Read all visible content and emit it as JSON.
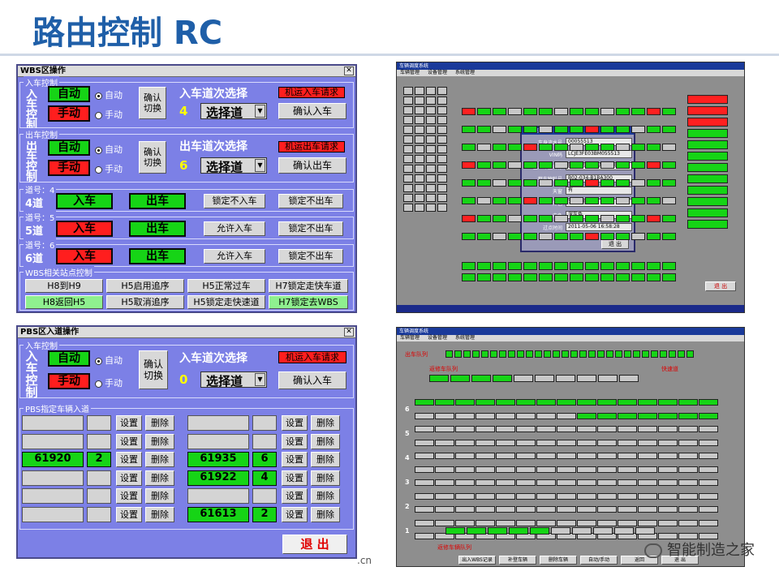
{
  "slide": {
    "title": "路由控制 RC",
    "footer_partial": ".cn",
    "watermark": "智能制造之家"
  },
  "wbs": {
    "title": "WBS区操作",
    "entry": {
      "group": "入车控制",
      "vlabel": "入车控制",
      "auto": "自动",
      "manual": "手动",
      "radio_auto": "自动",
      "radio_manual": "手动",
      "confirm_switch": "确认切换",
      "select_title": "入车道次选择",
      "lane": "4",
      "select": "选择道",
      "request": "机运入车请求",
      "confirm": "确认入车"
    },
    "exit": {
      "group": "出车控制",
      "vlabel": "出车控制",
      "auto": "自动",
      "manual": "手动",
      "radio_auto": "自动",
      "radio_manual": "手动",
      "confirm_switch": "确认切换",
      "select_title": "出车道次选择",
      "lane": "6",
      "select": "选择道",
      "request": "机运出车请求",
      "confirm": "确认出车"
    },
    "lanes": [
      {
        "group": "道号：4",
        "name": "4道",
        "in": "入车",
        "out": "出车",
        "b1": "锁定不入车",
        "b2": "锁定不出车"
      },
      {
        "group": "道号：5",
        "name": "5道",
        "in": "入车",
        "out": "出车",
        "b1": "允许入车",
        "b2": "锁定不出车"
      },
      {
        "group": "道号：6",
        "name": "6道",
        "in": "入车",
        "out": "出车",
        "b1": "允许入车",
        "b2": "锁定不出车"
      }
    ],
    "station": {
      "group": "WBS相关站点控制",
      "row1": [
        "H8到H9",
        "H5启用追序",
        "H5正常过车",
        "H7锁定走快车道"
      ],
      "row2": [
        "H8返回H5",
        "H5取消追序",
        "H5锁定走快速道",
        "H7锁定去WBS"
      ]
    }
  },
  "pbs": {
    "title": "PBS区入道操作",
    "entry": {
      "group": "入车控制",
      "vlabel": "入车控制",
      "auto": "自动",
      "manual": "手动",
      "radio_auto": "自动",
      "radio_manual": "手动",
      "confirm_switch": "确认切换",
      "select_title": "入车道次选择",
      "lane": "0",
      "select": "选择道",
      "request": "机运入车请求",
      "confirm": "确认入车"
    },
    "assign": {
      "group": "PBS指定车辆入道",
      "set": "设置",
      "del": "删除",
      "left": [
        {
          "car": "",
          "n": ""
        },
        {
          "car": "",
          "n": ""
        },
        {
          "car": "61920",
          "n": "2"
        },
        {
          "car": "",
          "n": ""
        },
        {
          "car": "",
          "n": ""
        },
        {
          "car": "",
          "n": ""
        }
      ],
      "right": [
        {
          "car": "",
          "n": ""
        },
        {
          "car": "",
          "n": ""
        },
        {
          "car": "61935",
          "n": "6"
        },
        {
          "car": "61922",
          "n": "4"
        },
        {
          "car": "",
          "n": ""
        },
        {
          "car": "61613",
          "n": "2"
        }
      ]
    },
    "exit_button": "退 出"
  },
  "screen1": {
    "title": "车辆调度系统",
    "menu": [
      "车辆管理",
      "设备管理",
      "系统管理"
    ],
    "popup": {
      "title": "车辆信息",
      "rows": [
        {
          "k": "车身流水号",
          "v": "00055513"
        },
        {
          "k": "VIN码",
          "v": "LCJE3FE03BM055513"
        },
        {
          "k": "生产车型名称",
          "v": "欧IV自动档豪华型(车身)"
        },
        {
          "k": "整车物料号",
          "v": "B02-034-B1BA300"
        },
        {
          "k": "天窗",
          "v": "有"
        },
        {
          "k": "外色",
          "v": "金属摩登蓝棕"
        },
        {
          "k": "内色",
          "v": "深灰色"
        },
        {
          "k": "过点时间",
          "v": "2011-05-06 16:58:28"
        }
      ],
      "exit": "退 出"
    },
    "exit": "退 出"
  },
  "screen2": {
    "title": "车辆调度系统",
    "menu": [
      "车辆管理",
      "设备管理",
      "系统管理"
    ],
    "queue_label": "出车队列",
    "lane_label1": "返修车队列",
    "lane_label2": "快速道",
    "bottom_label": "返修车辆队列",
    "buttons": [
      "出入WBS记录",
      "补登车辆",
      "删除车辆",
      "自动/手动",
      "返回",
      "退 出"
    ],
    "lane_nums": [
      "6",
      "5",
      "4",
      "3",
      "2",
      "1"
    ]
  }
}
